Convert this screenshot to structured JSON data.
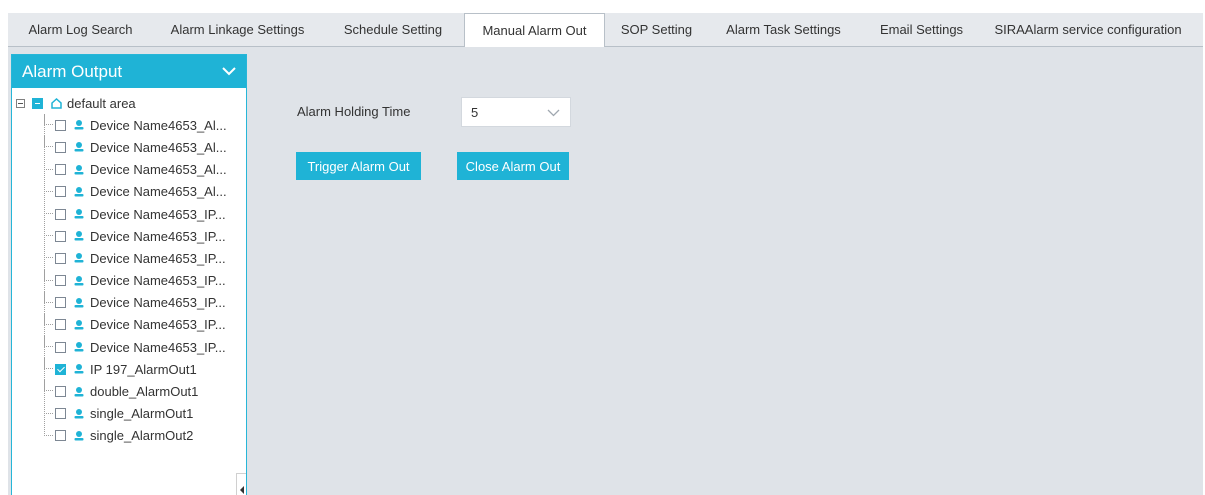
{
  "tabs": [
    {
      "label": "Alarm Log Search",
      "active": false
    },
    {
      "label": "Alarm Linkage Settings",
      "active": false
    },
    {
      "label": "Schedule Setting",
      "active": false
    },
    {
      "label": "Manual Alarm Out",
      "active": true
    },
    {
      "label": "SOP Setting",
      "active": false
    },
    {
      "label": "Alarm Task Settings",
      "active": false
    },
    {
      "label": "Email Settings",
      "active": false
    },
    {
      "label": "SIRAAlarm service configuration",
      "active": false
    }
  ],
  "panel": {
    "title": "Alarm Output",
    "root": {
      "label": "default area",
      "state": "partial"
    },
    "items": [
      {
        "label": "Device Name4653_Al...",
        "checked": false
      },
      {
        "label": "Device Name4653_Al...",
        "checked": false
      },
      {
        "label": "Device Name4653_Al...",
        "checked": false
      },
      {
        "label": "Device Name4653_Al...",
        "checked": false
      },
      {
        "label": "Device Name4653_IP...",
        "checked": false
      },
      {
        "label": "Device Name4653_IP...",
        "checked": false
      },
      {
        "label": "Device Name4653_IP...",
        "checked": false
      },
      {
        "label": "Device Name4653_IP...",
        "checked": false
      },
      {
        "label": "Device Name4653_IP...",
        "checked": false
      },
      {
        "label": "Device Name4653_IP...",
        "checked": false
      },
      {
        "label": "Device Name4653_IP...",
        "checked": false
      },
      {
        "label": "IP 197_AlarmOut1",
        "checked": true
      },
      {
        "label": "double_AlarmOut1",
        "checked": false
      },
      {
        "label": "single_AlarmOut1",
        "checked": false
      },
      {
        "label": "single_AlarmOut2",
        "checked": false
      }
    ]
  },
  "form": {
    "holding_time_label": "Alarm Holding Time",
    "holding_time_value": "5"
  },
  "buttons": {
    "trigger": "Trigger Alarm Out",
    "close": "Close Alarm Out"
  },
  "colors": {
    "accent": "#1fb3d6",
    "content_bg": "#dfe3e8",
    "tabbar_bg": "#e6e9ed"
  }
}
